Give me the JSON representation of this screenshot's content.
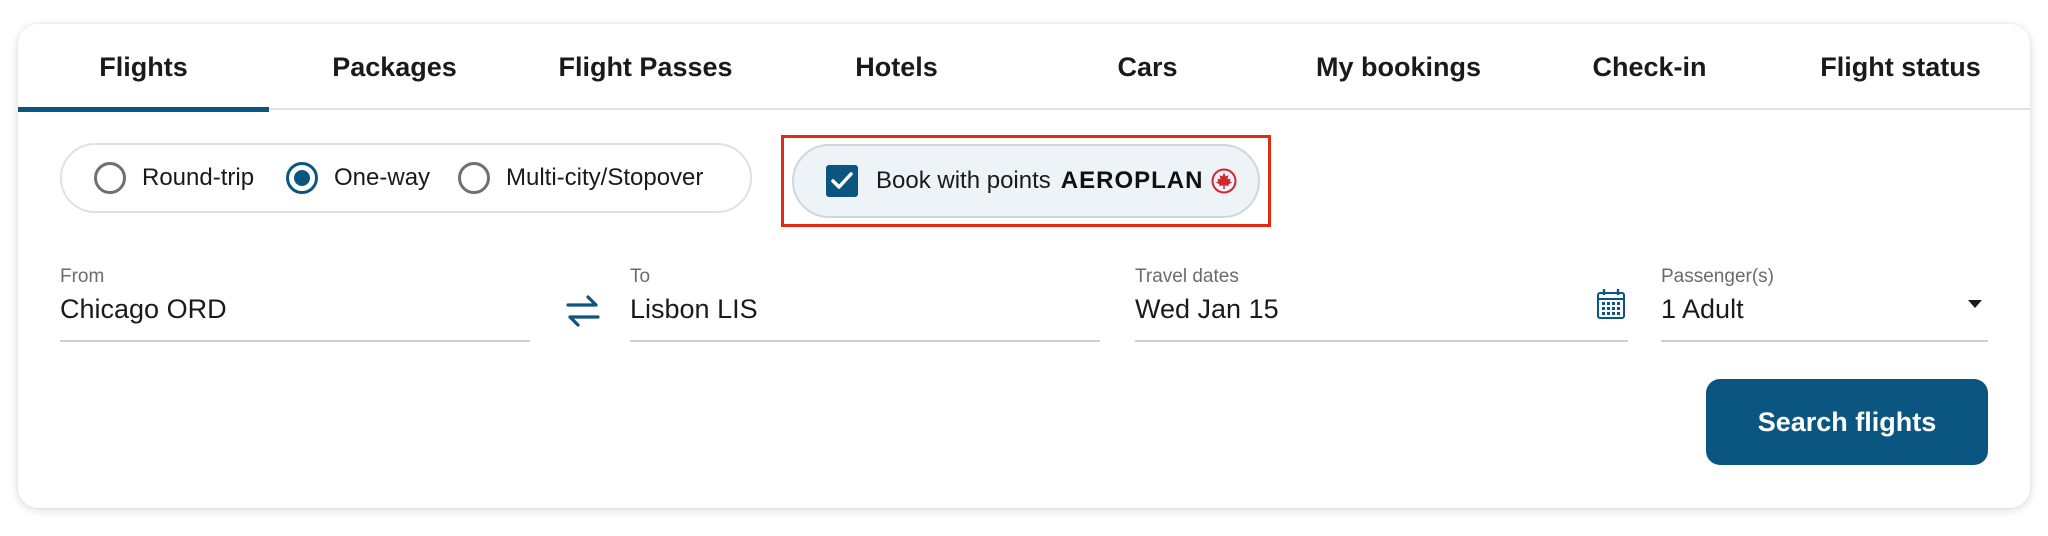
{
  "tabs": [
    {
      "label": "Flights",
      "active": true
    },
    {
      "label": "Packages",
      "active": false
    },
    {
      "label": "Flight Passes",
      "active": false
    },
    {
      "label": "Hotels",
      "active": false
    },
    {
      "label": "Cars",
      "active": false
    },
    {
      "label": "My bookings",
      "active": false
    },
    {
      "label": "Check-in",
      "active": false
    },
    {
      "label": "Flight status",
      "active": false
    }
  ],
  "trip_type": {
    "options": [
      "Round-trip",
      "One-way",
      "Multi-city/Stopover"
    ],
    "selected": "One-way"
  },
  "points": {
    "label": "Book with points",
    "brand": "AEROPLAN",
    "checked": true,
    "brand_icon": "maple-leaf-icon"
  },
  "from": {
    "label": "From",
    "value": "Chicago ORD"
  },
  "to": {
    "label": "To",
    "value": "Lisbon LIS"
  },
  "dates": {
    "label": "Travel dates",
    "value": "Wed Jan 15",
    "icon": "calendar-icon"
  },
  "passengers": {
    "label": "Passenger(s)",
    "value": "1 Adult",
    "icon": "caret-down-icon"
  },
  "swap_icon": "swap-arrows-icon",
  "search_button": {
    "label": "Search flights"
  },
  "colors": {
    "accent": "#0b5680",
    "highlight_border": "#e22b15",
    "points_bg": "#eef3f8",
    "brand_red": "#d22630"
  }
}
